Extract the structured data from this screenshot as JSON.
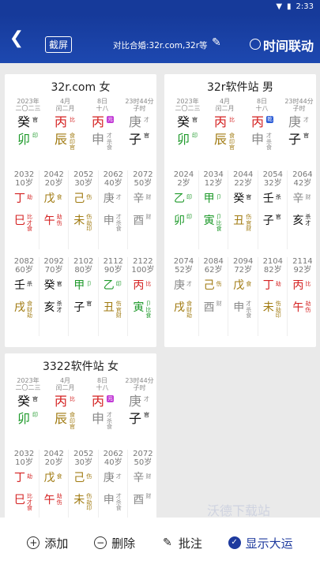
{
  "status": {
    "time": "2:33"
  },
  "header": {
    "screenshot_label": "截屏",
    "compare_text": "对比合婚:32r.com,32r等",
    "time_link_label": "时间联动"
  },
  "bottom": {
    "add": "添加",
    "delete": "删除",
    "annotate": "批注",
    "show_dayun": "显示大运"
  },
  "watermark": "沃德下载站",
  "colors": {
    "wood": "#1f9a2b",
    "fire": "#d42020",
    "earth": "#a07a10",
    "metal": "#8a8a8a",
    "water": "#111111",
    "brand": "#1e3a9e"
  },
  "cards": [
    {
      "title": "32r.com 女",
      "pillars": [
        {
          "top1": "2023年",
          "top2": "二〇二三",
          "gan": "癸",
          "gan_tag": "官",
          "gan_color": "water",
          "zhi": "卯",
          "zhi_color": "wood",
          "hidden": [
            "印"
          ],
          "hidden_color": "wood"
        },
        {
          "top1": "4月",
          "top2": "闰二月",
          "gan": "丙",
          "gan_tag": "比",
          "gan_color": "fire",
          "zhi": "辰",
          "zhi_color": "earth",
          "hidden": [
            "食",
            "印",
            "官"
          ],
          "hidden_color": "earth"
        },
        {
          "top1": "8日",
          "top2": "十八",
          "gan": "丙",
          "gan_tag": "元",
          "gan_color": "fire",
          "zhi": "申",
          "zhi_color": "metal",
          "hidden": [
            "才",
            "杀",
            "食"
          ],
          "hidden_color": "metal"
        },
        {
          "top1": "23时44分",
          "top2": "子时",
          "gan": "庚",
          "gan_tag": "才",
          "gan_color": "metal",
          "zhi": "子",
          "zhi_color": "water",
          "hidden": [
            "官"
          ],
          "hidden_color": "water"
        }
      ],
      "dayun": [
        [
          {
            "year": "2032",
            "age": "10岁",
            "gan": "丁",
            "gt": "劫",
            "gc": "fire",
            "zhi": "巳",
            "zt": [
              "比",
              "才",
              "食"
            ],
            "zc": "fire"
          },
          {
            "year": "2042",
            "age": "20岁",
            "gan": "戊",
            "gt": "食",
            "gc": "earth",
            "zhi": "午",
            "zt": [
              "劫",
              "伤"
            ],
            "zc": "fire"
          },
          {
            "year": "2052",
            "age": "30岁",
            "gan": "己",
            "gt": "伤",
            "gc": "earth",
            "zhi": "未",
            "zt": [
              "伤",
              "劫",
              "印"
            ],
            "zc": "earth"
          },
          {
            "year": "2062",
            "age": "40岁",
            "gan": "庚",
            "gt": "才",
            "gc": "metal",
            "zhi": "申",
            "zt": [
              "才",
              "杀",
              "食"
            ],
            "zc": "metal"
          },
          {
            "year": "2072",
            "age": "50岁",
            "gan": "辛",
            "gt": "财",
            "gc": "metal",
            "zhi": "酉",
            "zt": [
              "财"
            ],
            "zc": "metal"
          }
        ],
        [
          {
            "year": "2082",
            "age": "60岁",
            "gan": "壬",
            "gt": "杀",
            "gc": "water",
            "zhi": "戌",
            "zt": [
              "食",
              "财",
              "劫"
            ],
            "zc": "earth"
          },
          {
            "year": "2092",
            "age": "70岁",
            "gan": "癸",
            "gt": "官",
            "gc": "water",
            "zhi": "亥",
            "zt": [
              "杀",
              "才"
            ],
            "zc": "water"
          },
          {
            "year": "2102",
            "age": "80岁",
            "gan": "甲",
            "gt": "卩",
            "gc": "wood",
            "zhi": "子",
            "zt": [
              "官"
            ],
            "zc": "water"
          },
          {
            "year": "2112",
            "age": "90岁",
            "gan": "乙",
            "gt": "印",
            "gc": "wood",
            "zhi": "丑",
            "zt": [
              "伤",
              "官",
              "财"
            ],
            "zc": "earth"
          },
          {
            "year": "2122",
            "age": "100岁",
            "gan": "丙",
            "gt": "比",
            "gc": "fire",
            "zhi": "寅",
            "zt": [
              "卩",
              "比",
              "食"
            ],
            "zc": "wood"
          }
        ]
      ]
    },
    {
      "title": "32r软件站 男",
      "pillars": [
        {
          "top1": "2023年",
          "top2": "二〇二三",
          "gan": "癸",
          "gan_tag": "官",
          "gan_color": "water",
          "zhi": "卯",
          "zhi_color": "wood",
          "hidden": [
            "印"
          ],
          "hidden_color": "wood"
        },
        {
          "top1": "4月",
          "top2": "闰二月",
          "gan": "丙",
          "gan_tag": "比",
          "gan_color": "fire",
          "zhi": "辰",
          "zhi_color": "earth",
          "hidden": [
            "食",
            "印",
            "官"
          ],
          "hidden_color": "earth"
        },
        {
          "top1": "8日",
          "top2": "十八",
          "gan": "丙",
          "gan_tag": "乾",
          "gan_color": "fire",
          "zhi": "申",
          "zhi_color": "metal",
          "hidden": [
            "才",
            "杀",
            "食"
          ],
          "hidden_color": "metal"
        },
        {
          "top1": "23时44分",
          "top2": "子时",
          "gan": "庚",
          "gan_tag": "才",
          "gan_color": "metal",
          "zhi": "子",
          "zhi_color": "water",
          "hidden": [
            "官"
          ],
          "hidden_color": "water"
        }
      ],
      "dayun": [
        [
          {
            "year": "2024",
            "age": "2岁",
            "gan": "乙",
            "gt": "印",
            "gc": "wood",
            "zhi": "卯",
            "zt": [
              "印"
            ],
            "zc": "wood"
          },
          {
            "year": "2034",
            "age": "12岁",
            "gan": "甲",
            "gt": "卩",
            "gc": "wood",
            "zhi": "寅",
            "zt": [
              "卩",
              "比",
              "食"
            ],
            "zc": "wood"
          },
          {
            "year": "2044",
            "age": "22岁",
            "gan": "癸",
            "gt": "官",
            "gc": "water",
            "zhi": "丑",
            "zt": [
              "伤",
              "官",
              "财"
            ],
            "zc": "earth"
          },
          {
            "year": "2054",
            "age": "32岁",
            "gan": "壬",
            "gt": "杀",
            "gc": "water",
            "zhi": "子",
            "zt": [
              "官"
            ],
            "zc": "water"
          },
          {
            "year": "2064",
            "age": "42岁",
            "gan": "辛",
            "gt": "财",
            "gc": "metal",
            "zhi": "亥",
            "zt": [
              "杀",
              "才"
            ],
            "zc": "water"
          }
        ],
        [
          {
            "year": "2074",
            "age": "52岁",
            "gan": "庚",
            "gt": "才",
            "gc": "metal",
            "zhi": "戌",
            "zt": [
              "食",
              "财",
              "劫"
            ],
            "zc": "earth"
          },
          {
            "year": "2084",
            "age": "62岁",
            "gan": "己",
            "gt": "伤",
            "gc": "earth",
            "zhi": "酉",
            "zt": [
              "财"
            ],
            "zc": "metal"
          },
          {
            "year": "2094",
            "age": "72岁",
            "gan": "戊",
            "gt": "食",
            "gc": "earth",
            "zhi": "申",
            "zt": [
              "才",
              "杀",
              "食"
            ],
            "zc": "metal"
          },
          {
            "year": "2104",
            "age": "82岁",
            "gan": "丁",
            "gt": "劫",
            "gc": "fire",
            "zhi": "未",
            "zt": [
              "伤",
              "劫",
              "印"
            ],
            "zc": "earth"
          },
          {
            "year": "2114",
            "age": "92岁",
            "gan": "丙",
            "gt": "比",
            "gc": "fire",
            "zhi": "午",
            "zt": [
              "劫",
              "伤"
            ],
            "zc": "fire"
          }
        ]
      ]
    },
    {
      "title": "3322软件站 女",
      "pillars": [
        {
          "top1": "2023年",
          "top2": "二〇二三",
          "gan": "癸",
          "gan_tag": "官",
          "gan_color": "water",
          "zhi": "卯",
          "zhi_color": "wood",
          "hidden": [
            "印"
          ],
          "hidden_color": "wood"
        },
        {
          "top1": "4月",
          "top2": "闰二月",
          "gan": "丙",
          "gan_tag": "比",
          "gan_color": "fire",
          "zhi": "辰",
          "zhi_color": "earth",
          "hidden": [
            "食",
            "印",
            "官"
          ],
          "hidden_color": "earth"
        },
        {
          "top1": "8日",
          "top2": "十八",
          "gan": "丙",
          "gan_tag": "元",
          "gan_color": "fire",
          "zhi": "申",
          "zhi_color": "metal",
          "hidden": [
            "才",
            "杀",
            "食"
          ],
          "hidden_color": "metal"
        },
        {
          "top1": "23时44分",
          "top2": "子时",
          "gan": "庚",
          "gan_tag": "才",
          "gan_color": "metal",
          "zhi": "子",
          "zhi_color": "water",
          "hidden": [
            "官"
          ],
          "hidden_color": "water"
        }
      ],
      "dayun": [
        [
          {
            "year": "2032",
            "age": "10岁",
            "gan": "丁",
            "gt": "劫",
            "gc": "fire",
            "zhi": "巳",
            "zt": [
              "比",
              "才",
              "食"
            ],
            "zc": "fire"
          },
          {
            "year": "2042",
            "age": "20岁",
            "gan": "戊",
            "gt": "食",
            "gc": "earth",
            "zhi": "午",
            "zt": [
              "劫",
              "伤"
            ],
            "zc": "fire"
          },
          {
            "year": "2052",
            "age": "30岁",
            "gan": "己",
            "gt": "伤",
            "gc": "earth",
            "zhi": "未",
            "zt": [
              "伤",
              "劫",
              "印"
            ],
            "zc": "earth"
          },
          {
            "year": "2062",
            "age": "40岁",
            "gan": "庚",
            "gt": "才",
            "gc": "metal",
            "zhi": "申",
            "zt": [
              "才",
              "杀",
              "食"
            ],
            "zc": "metal"
          },
          {
            "year": "2072",
            "age": "50岁",
            "gan": "辛",
            "gt": "财",
            "gc": "metal",
            "zhi": "酉",
            "zt": [
              "财"
            ],
            "zc": "metal"
          }
        ]
      ]
    }
  ]
}
